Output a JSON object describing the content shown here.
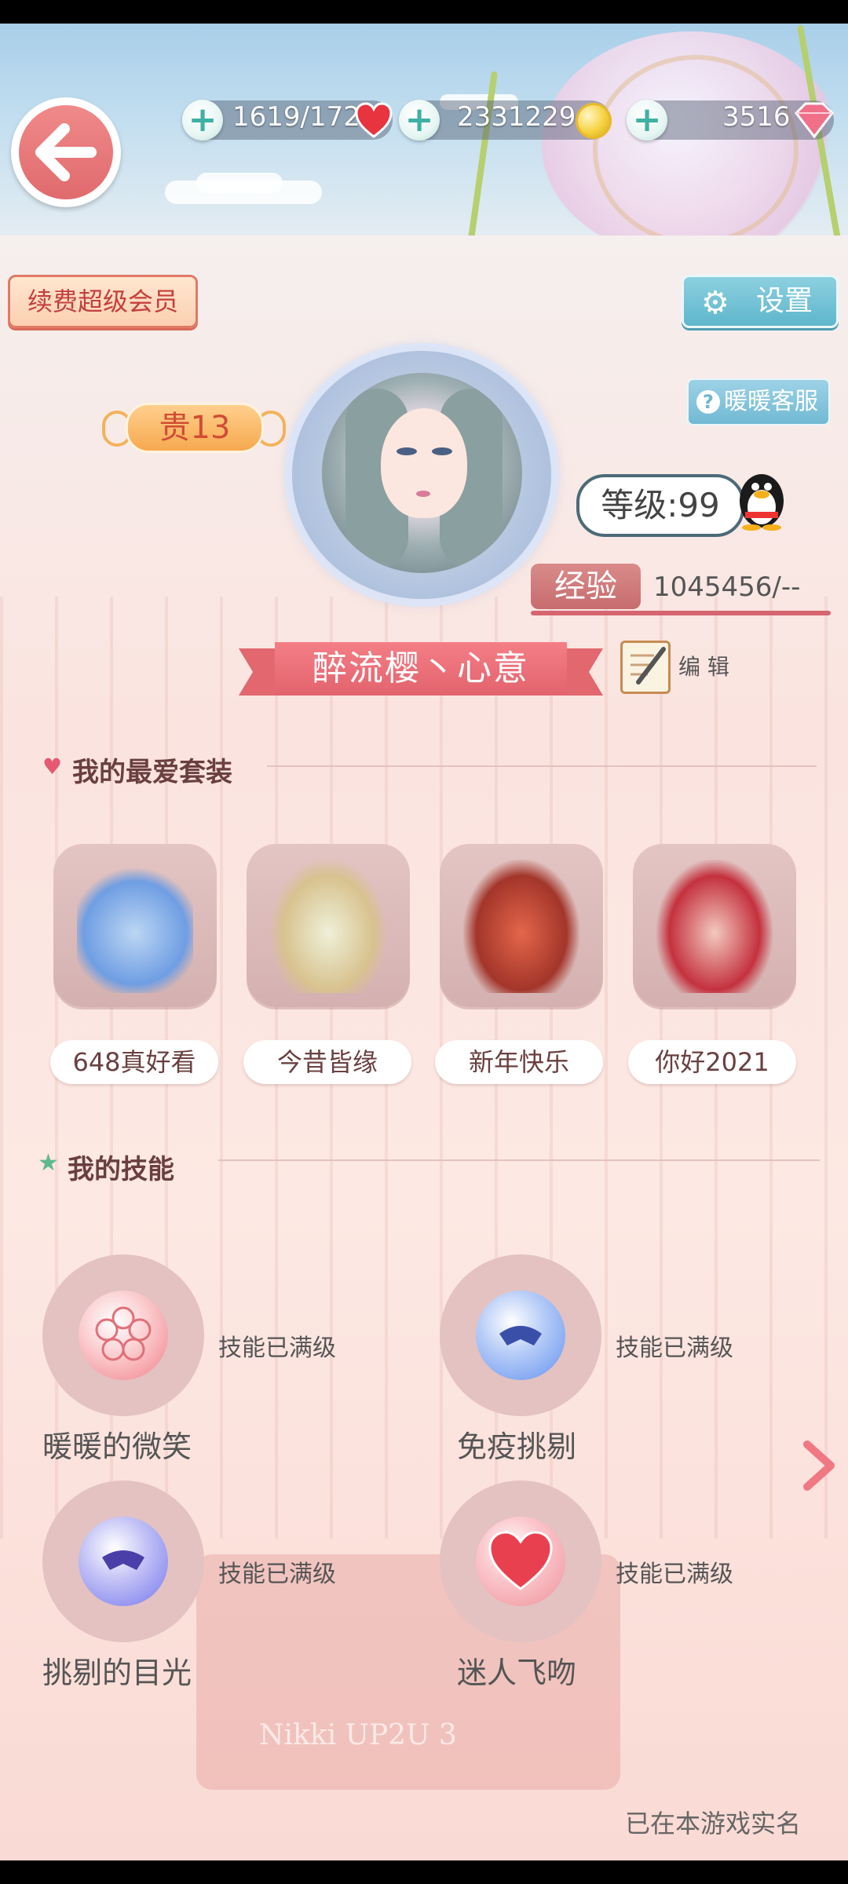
{
  "header": {
    "stamina": "1619/172",
    "coins": "2331229",
    "diamonds": "3516"
  },
  "buttons": {
    "renew_vip": "续费超级会员",
    "settings": "设置",
    "customer_service": "暖暖客服",
    "edit": "编 辑"
  },
  "profile": {
    "noble_level": "贵13",
    "level": "等级:99",
    "exp_label": "经验",
    "exp_value": "1045456/--",
    "nickname": "醉流樱丶心意"
  },
  "favorites": {
    "title": "我的最爱套装",
    "items": [
      {
        "label": "648真好看",
        "colors": [
          "#6f9ee3",
          "#bcd6f3"
        ]
      },
      {
        "label": "今昔皆缘",
        "colors": [
          "#d8c28f",
          "#eef0d8"
        ]
      },
      {
        "label": "新年快乐",
        "colors": [
          "#a3352a",
          "#e3664a"
        ]
      },
      {
        "label": "你好2021",
        "colors": [
          "#c4313e",
          "#f3c9bf"
        ]
      }
    ]
  },
  "skills": {
    "title": "我的技能",
    "items": [
      {
        "name": "暖暖的微笑",
        "status": "技能已满级",
        "icon": "sakura-icon",
        "color": "#f49aa0"
      },
      {
        "name": "免疫挑剔",
        "status": "技能已满级",
        "icon": "winged-mask-icon",
        "color": "#7ea5f2"
      },
      {
        "name": "挑剔的目光",
        "status": "技能已满级",
        "icon": "mask-icon",
        "color": "#8e8ff0"
      },
      {
        "name": "迷人飞吻",
        "status": "技能已满级",
        "icon": "heart-icon",
        "color": "#f0707c"
      }
    ]
  },
  "footer": {
    "realname_note": "已在本游戏实名"
  },
  "bus_sign": "Nikki UP2U 3"
}
